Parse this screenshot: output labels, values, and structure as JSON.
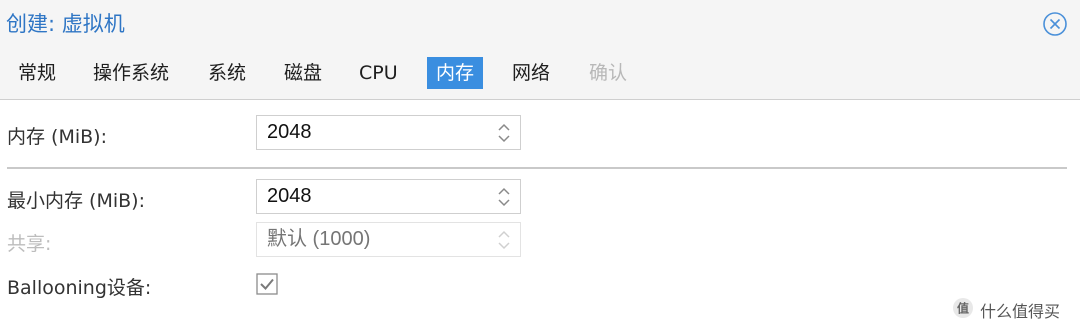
{
  "dialog": {
    "title": "创建: 虚拟机",
    "close_icon": "close-circle-icon"
  },
  "tabs": [
    {
      "label": "常规",
      "state": "normal"
    },
    {
      "label": "操作系统",
      "state": "normal"
    },
    {
      "label": "系统",
      "state": "normal"
    },
    {
      "label": "磁盘",
      "state": "normal"
    },
    {
      "label": "CPU",
      "state": "normal"
    },
    {
      "label": "内存",
      "state": "active"
    },
    {
      "label": "网络",
      "state": "normal"
    },
    {
      "label": "确认",
      "state": "disabled"
    }
  ],
  "form": {
    "memory": {
      "label": "内存 (MiB):",
      "value": "2048"
    },
    "min_memory": {
      "label": "最小内存 (MiB):",
      "value": "2048"
    },
    "shares": {
      "label": "共享:",
      "placeholder": "默认 (1000)",
      "disabled": true
    },
    "ballooning": {
      "label": "Ballooning设备:",
      "checked": true
    }
  },
  "watermark": {
    "text": "什么值得买"
  },
  "colors": {
    "title": "#2f76c5",
    "tab_active_bg": "#3a8ee0",
    "tab_disabled": "#b8b8b8",
    "header_bg": "#f5f5f5"
  }
}
